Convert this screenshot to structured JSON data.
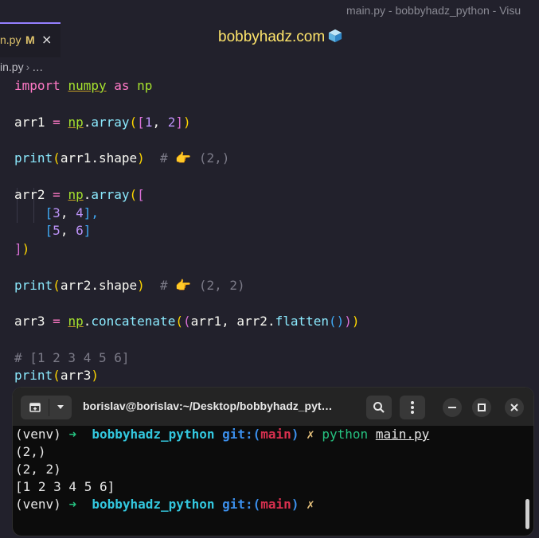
{
  "window": {
    "title": "main.py - bobbyhadz_python - Visu"
  },
  "tab": {
    "name": "n.py",
    "modified": "M",
    "close": "×"
  },
  "overlay": {
    "site": "bobbyhadz.com"
  },
  "breadcrumb": {
    "file": "in.py",
    "rest": "…"
  },
  "code": {
    "l1": {
      "kw": "import",
      "mod": "numpy",
      "as": "as",
      "alias": "np"
    },
    "l2": {
      "var": "arr1",
      "eq": "=",
      "np": "np",
      "dot": ".",
      "fn": "array",
      "p1": "(",
      "b1": "[",
      "n1": "1",
      "comma": ", ",
      "n2": "2",
      "b2": "]",
      "p2": ")"
    },
    "l3": {
      "fn": "print",
      "p1": "(",
      "arg": "arr1.shape",
      "p2": ")",
      "comment": "  # 👉 (2,)"
    },
    "l4": {
      "var": "arr2",
      "eq": "=",
      "np": "np",
      "dot": ".",
      "fn": "array",
      "p1": "(",
      "b1": "["
    },
    "l5": {
      "open": "[",
      "n1": "3",
      "comma": ", ",
      "n2": "4",
      "close": "],"
    },
    "l6": {
      "open": "[",
      "n1": "5",
      "comma": ", ",
      "n2": "6",
      "close": "]"
    },
    "l7": {
      "b": "]",
      "p": ")"
    },
    "l8": {
      "fn": "print",
      "p1": "(",
      "arg": "arr2.shape",
      "p2": ")",
      "comment": "  # 👉 (2, 2)"
    },
    "l9": {
      "var": "arr3",
      "eq": "=",
      "np": "np",
      "dot": ".",
      "fn": "concatenate",
      "p1": "(",
      "p2": "(",
      "a1": "arr1, arr2.",
      "fn2": "flatten",
      "p3": "()",
      "p4": ")",
      "p5": ")"
    },
    "l10": {
      "comment": "# [1 2 3 4 5 6]"
    },
    "l11": {
      "fn": "print",
      "p1": "(",
      "arg": "arr3",
      "p2": ")"
    }
  },
  "terminal": {
    "title": "borislav@borislav:~/Desktop/bobbyhadz_pyt…",
    "prompt": {
      "venv": "(venv)",
      "arrow": "➜",
      "dir": "bobbyhadz_python",
      "git": "git:(",
      "branch": "main",
      "git_close": ")",
      "dirty": "✗"
    },
    "command": "python",
    "argument": "main.py",
    "output": [
      "(2,)",
      "(2, 2)",
      "[1 2 3 4 5 6]"
    ]
  }
}
